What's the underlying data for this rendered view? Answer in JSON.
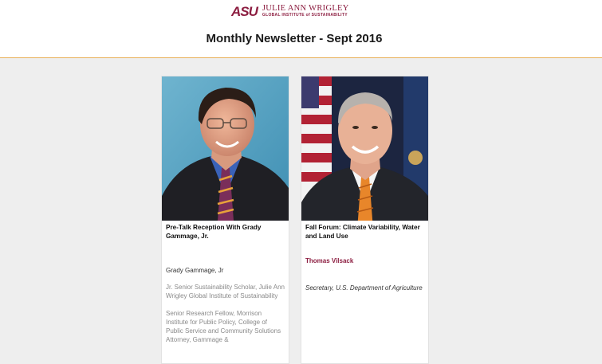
{
  "header": {
    "logo_mark": "ASU",
    "logo_name": "JULIE ANN WRIGLEY",
    "logo_subtitle": "GLOBAL INSTITUTE of SUSTAINABILITY",
    "title": "Monthly Newsletter - Sept 2016"
  },
  "cards": [
    {
      "title": "Pre-Talk Reception With Grady Gammage, Jr.",
      "person_name": "Grady Gammage, Jr",
      "role": "Jr. Senior Sustainability Scholar, Julie Ann Wrigley Global Institute of Sustainability",
      "bio": "Senior Research Fellow, Morrison Institute for Public Policy, College of Public Service and Community Solutions Attorney, Gammage &"
    },
    {
      "title": "Fall Forum: Climate Variability, Water and Land Use",
      "person_name": "Thomas Vilsack",
      "role": "Secretary, U.S. Department of Agriculture"
    }
  ],
  "colors": {
    "accent": "#8c1d40",
    "gold": "#ffc627",
    "divider": "#e8b15a"
  }
}
